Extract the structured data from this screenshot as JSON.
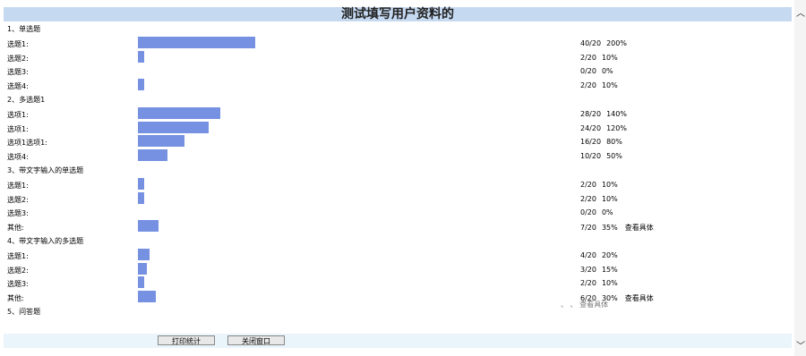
{
  "window": {
    "title": "测试填写用户资料的"
  },
  "questions": [
    {
      "title": "1、单选题",
      "options": [
        {
          "label": "选题1:",
          "count": "40/20",
          "pct_text": "200%",
          "ratio": 2.0,
          "detail": ""
        },
        {
          "label": "选题2:",
          "count": "2/20",
          "pct_text": "10%",
          "ratio": 0.1,
          "detail": ""
        },
        {
          "label": "选题3:",
          "count": "0/20",
          "pct_text": "0%",
          "ratio": 0.0,
          "detail": ""
        },
        {
          "label": "选题4:",
          "count": "2/20",
          "pct_text": "10%",
          "ratio": 0.1,
          "detail": ""
        }
      ]
    },
    {
      "title": "2、多选题1",
      "options": [
        {
          "label": "选项1:",
          "count": "28/20",
          "pct_text": "140%",
          "ratio": 1.4,
          "detail": ""
        },
        {
          "label": "选项1:",
          "count": "24/20",
          "pct_text": "120%",
          "ratio": 1.2,
          "detail": ""
        },
        {
          "label": "选项1选项1:",
          "count": "16/20",
          "pct_text": "80%",
          "ratio": 0.8,
          "detail": ""
        },
        {
          "label": "选项4:",
          "count": "10/20",
          "pct_text": "50%",
          "ratio": 0.5,
          "detail": ""
        }
      ]
    },
    {
      "title": "3、带文字输入的单选题",
      "options": [
        {
          "label": "选题1:",
          "count": "2/20",
          "pct_text": "10%",
          "ratio": 0.1,
          "detail": ""
        },
        {
          "label": "选题2:",
          "count": "2/20",
          "pct_text": "10%",
          "ratio": 0.1,
          "detail": ""
        },
        {
          "label": "选题3:",
          "count": "0/20",
          "pct_text": "0%",
          "ratio": 0.0,
          "detail": ""
        },
        {
          "label": "其他:",
          "count": "7/20",
          "pct_text": "35%",
          "ratio": 0.35,
          "detail": "查看具体"
        }
      ]
    },
    {
      "title": "4、带文字输入的多选题",
      "options": [
        {
          "label": "选题1:",
          "count": "4/20",
          "pct_text": "20%",
          "ratio": 0.2,
          "detail": ""
        },
        {
          "label": "选题2:",
          "count": "3/20",
          "pct_text": "15%",
          "ratio": 0.15,
          "detail": ""
        },
        {
          "label": "选题3:",
          "count": "2/20",
          "pct_text": "10%",
          "ratio": 0.1,
          "detail": ""
        },
        {
          "label": "其他:",
          "count": "6/20",
          "pct_text": "30%",
          "ratio": 0.3,
          "detail": "查看具体"
        }
      ]
    },
    {
      "title": "5、问答题",
      "options": []
    }
  ],
  "partial_text": "、 、 查看具体",
  "buttons": {
    "print": "打印统计",
    "close": "关闭窗口"
  },
  "colors": {
    "title_bg": "#c5d9f1",
    "bar": "#7690e2",
    "bottom_bg": "#eaf4fb"
  },
  "scrollbar": {
    "up_icon": "chevron-up-icon",
    "down_icon": "chevron-down-icon"
  }
}
